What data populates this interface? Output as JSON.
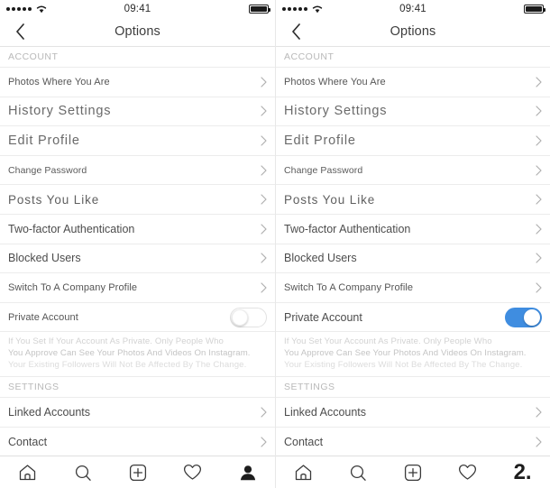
{
  "status_bar": {
    "signal_dots": 5,
    "wifi_icon": "wifi-icon",
    "time": "09:41",
    "battery_icon": "battery-full-icon"
  },
  "header": {
    "back_icon": "chevron-left-icon",
    "title": "Options"
  },
  "sections": {
    "account_header": "ACCOUNT",
    "settings_header": "SETTINGS"
  },
  "account_rows": [
    {
      "label": "Photos Where You Are",
      "variant": "v-small"
    },
    {
      "label": "History Settings",
      "variant": "v-big"
    },
    {
      "label": "Edit Profile",
      "variant": "v-big"
    },
    {
      "label": "Change Password",
      "variant": "v-faint"
    },
    {
      "label": "Posts You Like",
      "variant": "v-wide"
    },
    {
      "label": "Two-factor Authentication",
      "variant": "v-norm"
    },
    {
      "label": "Blocked Users",
      "variant": "v-norm"
    },
    {
      "label": "Switch To A Company Profile",
      "variant": "v-small"
    }
  ],
  "private_account": {
    "label": "Private Account",
    "toggle_left_state": "off",
    "toggle_right_state": "on",
    "toggle_on_color": "#3f8de0",
    "toggle_off_color": "#ffffff"
  },
  "footnote": {
    "line1": "If You Set If Your Account As Private. Only People Who",
    "line2": "You Approve Can See Your Photos And Videos On Instagram.",
    "line3": "Your Existing Followers Will Not Be Affected By The Change.",
    "line1_right": "If You Set Your Account As Private. Only People Who",
    "line2_right": "You Approve Can See Your Photos And Videos On Instagram.",
    "line3_right": "Your Existing Followers Will Not Be Affected By The Change."
  },
  "settings_rows": [
    {
      "label": "Linked Accounts"
    },
    {
      "label": "Contact"
    }
  ],
  "tabbar": {
    "items": [
      {
        "icon": "home-icon"
      },
      {
        "icon": "search-icon"
      },
      {
        "icon": "add-post-icon"
      },
      {
        "icon": "heart-icon"
      },
      {
        "icon": "profile-icon"
      }
    ],
    "right_last_glyph": "2."
  },
  "colors": {
    "separator": "#ececec",
    "label_text": "#4c4c4c",
    "section_header_text": "#b9b9b9",
    "footnote_text": "#d2d2d2",
    "accent_blue": "#3f8de0"
  }
}
